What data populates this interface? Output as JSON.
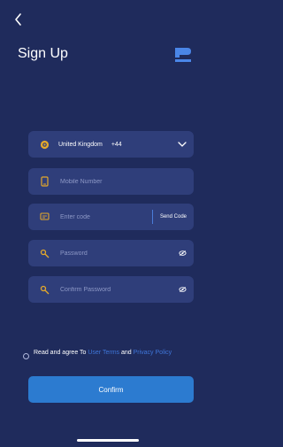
{
  "header": {
    "title": "Sign Up"
  },
  "country": {
    "name": "United Kingdom",
    "code": "+44"
  },
  "fields": {
    "mobile_placeholder": "Mobile Number",
    "code_placeholder": "Enter code",
    "send_code_label": "Send Code",
    "password_placeholder": "Password",
    "confirm_password_placeholder": "Confirm Password"
  },
  "agreement": {
    "prefix": "Read and agree To ",
    "terms": "User Terms",
    "and": " and ",
    "privacy": "Privacy Policy"
  },
  "confirm_label": "Confirm",
  "colors": {
    "background": "#1f2b5c",
    "field": "#2f3e7a",
    "accent": "#2c7bd0",
    "link": "#3f76d9",
    "icon": "#e5a92b"
  },
  "icons": [
    "back-arrow-icon",
    "brand-logo",
    "globe-icon",
    "chevron-down-icon",
    "phone-icon",
    "message-icon",
    "key-icon",
    "eye-icon"
  ]
}
